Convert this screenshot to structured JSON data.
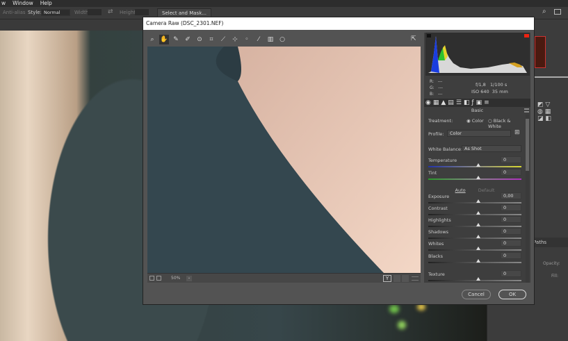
{
  "menubar": {
    "items": [
      "w",
      "Window",
      "Help"
    ]
  },
  "options": {
    "anti_alias": "Anti-alias",
    "style_label": "Style:",
    "style_value": "Normal",
    "width_label": "Width:",
    "height_label": "Height:",
    "select_mask": "Select and Mask..."
  },
  "dialog": {
    "title": "Camera Raw (DSC_2301.NEF)",
    "zoom": "50%",
    "info": {
      "r": "R:",
      "g": "G:",
      "b": "B:",
      "dash": "---",
      "aperture": "f/1,8",
      "shutter": "1/100 s",
      "iso": "ISO 640",
      "focal": "35 mm"
    },
    "panel_title": "Basic",
    "treatment_label": "Treatment:",
    "treatment_color": "Color",
    "treatment_bw": "Black & White",
    "profile_label": "Profile:",
    "profile_value": "Color",
    "wb_label": "White Balance:",
    "wb_value": "As Shot",
    "auto": "Auto",
    "default": "Default",
    "sliders": [
      {
        "label": "Temperature",
        "value": "0"
      },
      {
        "label": "Tint",
        "value": "0"
      },
      {
        "label": "Exposure",
        "value": "0,00"
      },
      {
        "label": "Contrast",
        "value": "0"
      },
      {
        "label": "Highlights",
        "value": "0"
      },
      {
        "label": "Shadows",
        "value": "0"
      },
      {
        "label": "Whites",
        "value": "0"
      },
      {
        "label": "Blacks",
        "value": "0"
      },
      {
        "label": "Texture",
        "value": "0"
      }
    ],
    "cancel": "Cancel",
    "ok": "OK"
  },
  "right_panel": {
    "paths": "Paths",
    "opacity": "Opacity:",
    "fill": "Fill:"
  }
}
